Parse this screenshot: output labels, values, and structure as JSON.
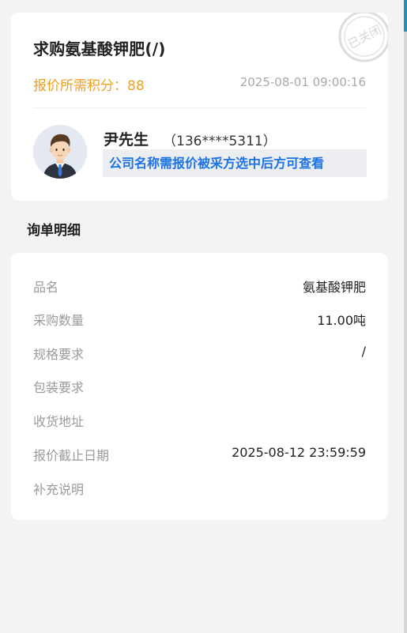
{
  "header": {
    "title": "求购氨基酸钾肥(/)",
    "points_label": "报价所需积分：",
    "points_value": "88",
    "timestamp": "2025-08-01 09:00:16",
    "stamp_text": "已关闭"
  },
  "contact": {
    "name": "尹先生",
    "phone": "（136****5311）",
    "company_notice": "公司名称需报价被采方选中后方可查看"
  },
  "details": {
    "section_title": "询单明细",
    "rows": [
      {
        "label": "品名",
        "value": "氨基酸钾肥"
      },
      {
        "label": "采购数量",
        "value": "11.00吨"
      },
      {
        "label": "规格要求",
        "value": "/"
      },
      {
        "label": "包装要求",
        "value": ""
      },
      {
        "label": "收货地址",
        "value": ""
      },
      {
        "label": "报价截止日期",
        "value": "2025-08-12 23:59:59"
      },
      {
        "label": "补充说明",
        "value": ""
      }
    ]
  },
  "colors": {
    "accent_orange": "#f0a020",
    "link_blue": "#1a73e8",
    "background": "#f3f3f3"
  }
}
